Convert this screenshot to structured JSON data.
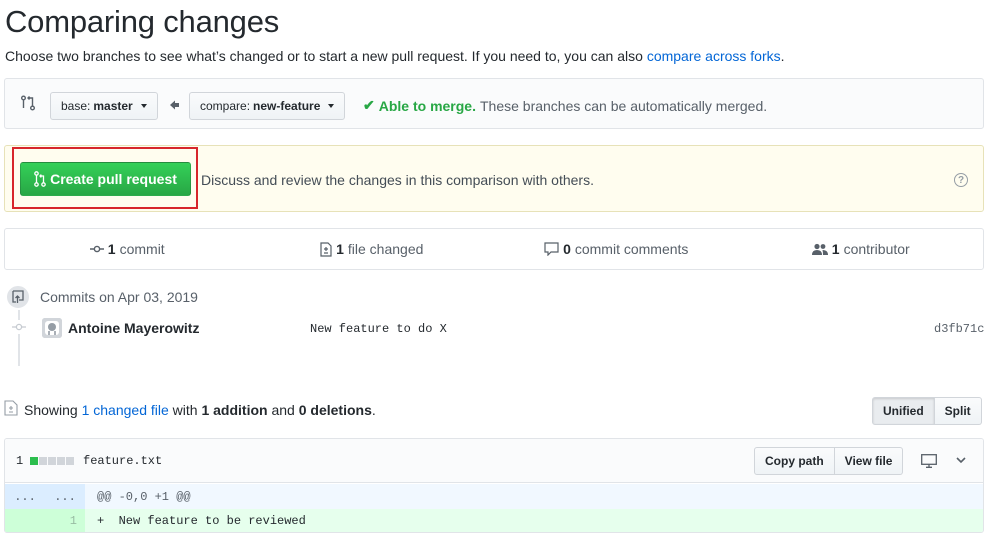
{
  "header": {
    "title": "Comparing changes",
    "subtitle": "Choose two branches to see what’s changed or to start a new pull request. If you need to, you can also ",
    "subtitle_link": "compare across forks",
    "subtitle_end": "."
  },
  "range": {
    "base_prefix": "base:",
    "base_branch": "master",
    "compare_prefix": "compare:",
    "compare_branch": "new-feature",
    "merge_check": "✔",
    "merge_status": "Able to merge.",
    "merge_detail": "These branches can be automatically merged."
  },
  "pull_request": {
    "button_label": "Create pull request",
    "description": "Discuss and review the changes in this comparison with others.",
    "help": "?"
  },
  "summary": {
    "commits_count": "1",
    "commits_label": "commit",
    "files_count": "1",
    "files_label": "file changed",
    "comments_count": "0",
    "comments_label": "commit comments",
    "contributors_count": "1",
    "contributors_label": "contributor"
  },
  "commits": {
    "date_header": "Commits on Apr 03, 2019",
    "items": [
      {
        "author": "Antoine Mayerowitz",
        "message": "New feature to do X",
        "sha": "d3fb71c"
      }
    ]
  },
  "files_summary": {
    "prefix": "Showing ",
    "changed_link": "1 changed file",
    "with": " with ",
    "additions": "1 addition",
    "and": " and ",
    "deletions": "0 deletions",
    "end": ".",
    "view_unified": "Unified",
    "view_split": "Split"
  },
  "file": {
    "diffstat_number": "1",
    "name": "feature.txt",
    "copy_path": "Copy path",
    "view_file": "View file",
    "hunk_left": "...",
    "hunk_right": "...",
    "hunk_header": "@@ -0,0 +1 @@",
    "added_line_number": "1",
    "added_line": "+  New feature to be reviewed"
  },
  "colors": {
    "accent_link": "#0366d6",
    "success_green": "#28a745",
    "highlight_outline": "#d7262b"
  }
}
